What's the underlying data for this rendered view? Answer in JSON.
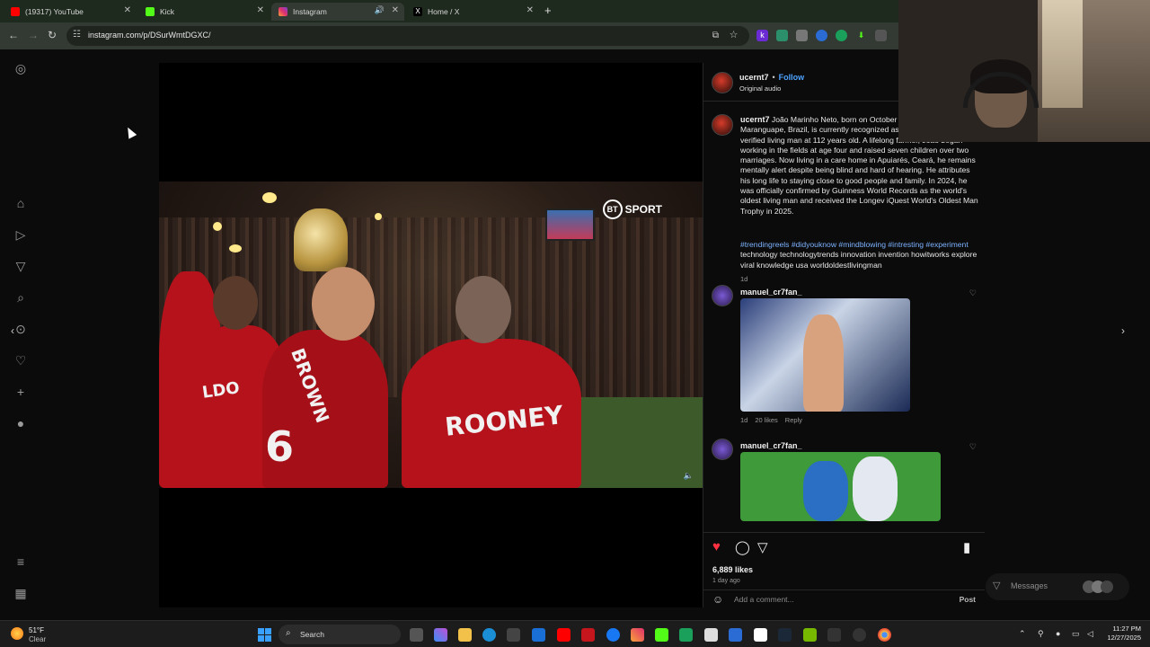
{
  "browser": {
    "tabs": [
      {
        "label": "(19317) YouTube",
        "favicon": "youtube-icon",
        "color": "#ff0000"
      },
      {
        "label": "Kick",
        "favicon": "kick-icon",
        "color": "#53fc18"
      },
      {
        "label": "Instagram",
        "favicon": "instagram-icon",
        "color": "#e1306c",
        "active": true
      },
      {
        "label": "Home / X",
        "favicon": "x-icon",
        "color": "#ffffff"
      }
    ],
    "url": "instagram.com/p/DSurWmtDGXC/"
  },
  "video": {
    "overlay_logo": "SPORT",
    "logo_badge": "BT",
    "jersey_names": [
      "LDO",
      "ROONEY",
      "BROWN"
    ],
    "jersey_number": "6"
  },
  "post": {
    "author": "ucernt7",
    "separator": "•",
    "follow_label": "Follow",
    "audio": "Original audio",
    "caption_author": "ucernt7",
    "caption": "João Marinho Neto, born on October 5, 1912, in Maranguape, Brazil, is currently recognized as the world's oldest verified living man at 112 years old. A lifelong farmer, João began working in the fields at age four and raised seven children over two marriages. Now living in a care home in Apuiarés, Ceará, he remains mentally alert despite being blind and hard of hearing. He attributes his long life to staying close to good people and family. In 2024, he was officially confirmed by Guinness World Records as the world's oldest living man and received the Longev iQuest World's Oldest Man Trophy in 2025.",
    "hashtags": [
      "#trendingreels",
      "#didyouknow",
      "#mindblowing",
      "#intresting",
      "#experiment"
    ],
    "tags_plain": "technology technologytrends innovation invention howitworks explore viral knowledge usa worldoldestlivingman",
    "caption_time": "1d",
    "comments": [
      {
        "user": "manuel_cr7fan_",
        "time": "1d",
        "likes": "20 likes",
        "reply": "Reply"
      },
      {
        "user": "manuel_cr7fan_"
      }
    ],
    "likes": "6,889 likes",
    "posted": "1 day ago",
    "comment_placeholder": "Add a comment...",
    "post_label": "Post"
  },
  "messages_label": "Messages",
  "taskbar": {
    "weather_temp": "51°F",
    "weather_desc": "Clear",
    "search_label": "Search",
    "time": "11:27 PM",
    "date": "12/27/2025"
  },
  "colors": {
    "like_red": "#ff3040",
    "link_blue": "#4da3ff",
    "hashtag_blue": "#7db2ff"
  }
}
